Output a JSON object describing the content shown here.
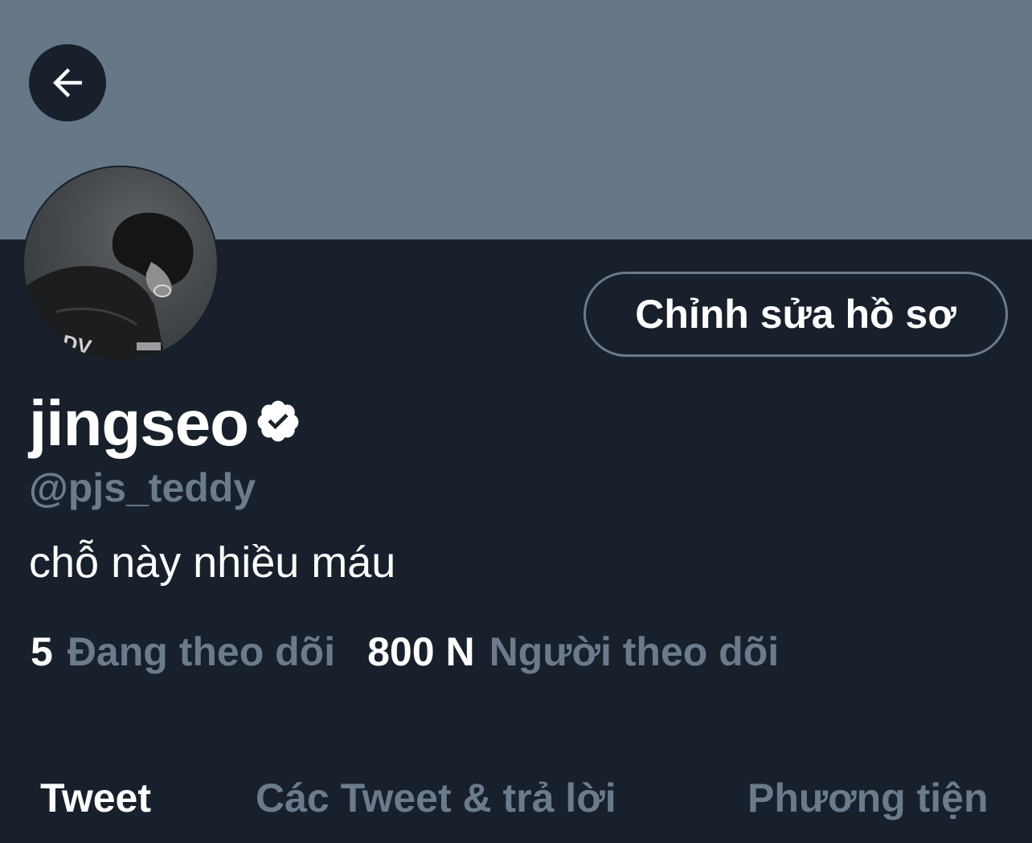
{
  "header": {
    "back_icon": "arrow-left-icon"
  },
  "colors": {
    "banner": "#667788",
    "background": "#17202b",
    "text_primary": "#ffffff",
    "text_secondary": "#6b7b8c"
  },
  "profile": {
    "edit_button_label": "Chỉnh sửa hồ sơ",
    "display_name": "jingseo",
    "verified_icon": "verified-badge-icon",
    "handle": "@pjs_teddy",
    "bio": "chỗ này nhiều máu"
  },
  "stats": {
    "following_count": "5",
    "following_label": "Đang theo dõi",
    "followers_count": "800 N",
    "followers_label": "Người theo dõi"
  },
  "tabs": [
    {
      "label": "Tweet",
      "active": true
    },
    {
      "label": "Các Tweet & trả lời",
      "active": false
    },
    {
      "label": "Phương tiện",
      "active": false
    }
  ]
}
